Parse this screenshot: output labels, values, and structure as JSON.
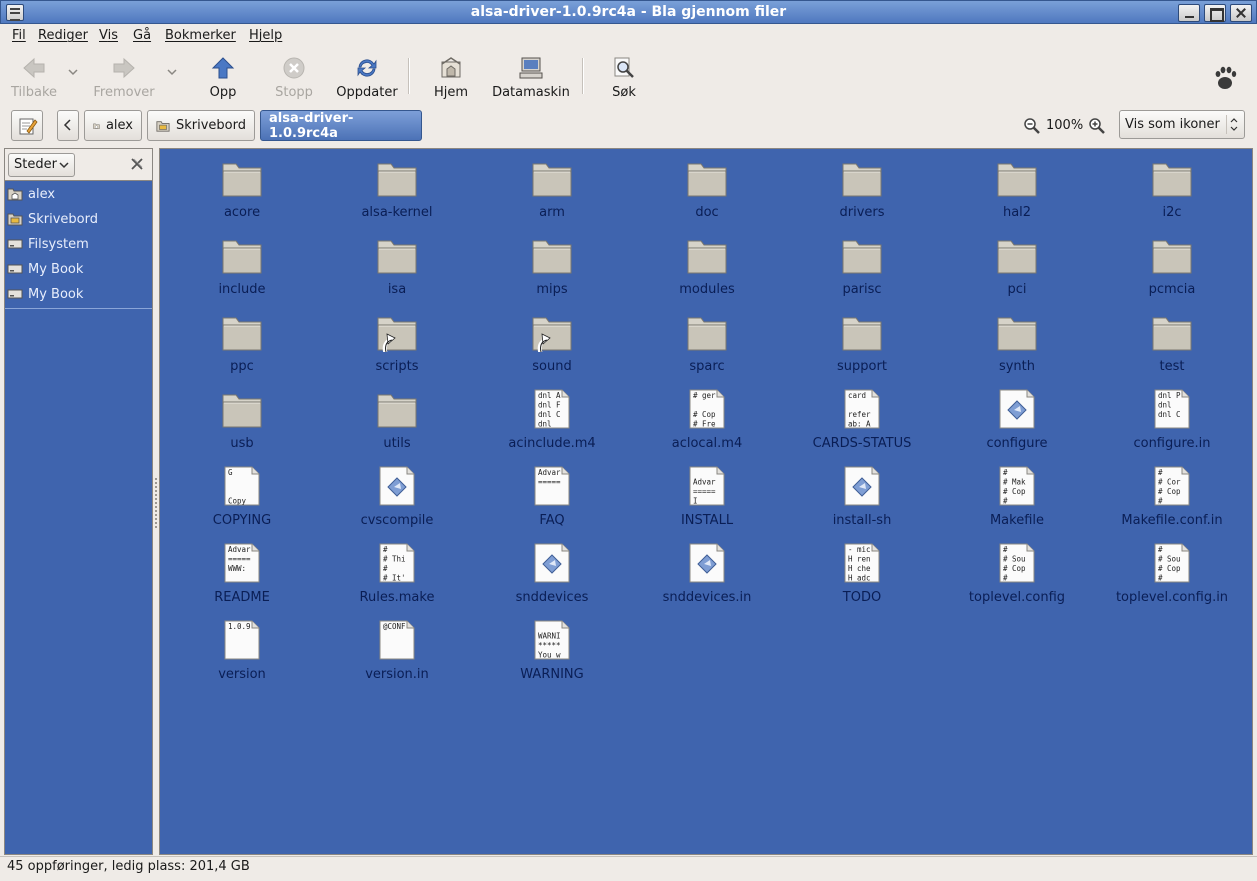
{
  "window": {
    "title": "alsa-driver-1.0.9rc4a - Bla gjennom filer"
  },
  "menubar": {
    "items": [
      {
        "label": "Fil",
        "accel": "F",
        "rest": "il"
      },
      {
        "label": "Rediger",
        "accel": "R",
        "rest": "ediger"
      },
      {
        "label": "Vis",
        "accel": "V",
        "rest": "is"
      },
      {
        "label": "Gå",
        "accel": "G",
        "rest": "å"
      },
      {
        "label": "Bokmerker",
        "accel": "B",
        "rest": "okmerker"
      },
      {
        "label": "Hjelp",
        "accel": "H",
        "rest": "jelp"
      }
    ]
  },
  "toolbar": {
    "back": "Tilbake",
    "forward": "Fremover",
    "up": "Opp",
    "stop": "Stopp",
    "reload": "Oppdater",
    "home": "Hjem",
    "computer": "Datamaskin",
    "search": "Søk"
  },
  "location": {
    "crumbs": [
      "alex",
      "Skrivebord",
      "alsa-driver-1.0.9rc4a"
    ],
    "zoom": "100%",
    "view_mode": "Vis som ikoner"
  },
  "sidepane": {
    "selector": "Steder",
    "places": [
      {
        "label": "alex",
        "icon": "home-folder-icon"
      },
      {
        "label": "Skrivebord",
        "icon": "desktop-icon"
      },
      {
        "label": "Filsystem",
        "icon": "drive-icon"
      },
      {
        "label": "My Book",
        "icon": "drive-icon"
      },
      {
        "label": "My Book",
        "icon": "drive-icon"
      }
    ]
  },
  "files": [
    {
      "name": "acore",
      "type": "folder"
    },
    {
      "name": "alsa-kernel",
      "type": "folder"
    },
    {
      "name": "arm",
      "type": "folder"
    },
    {
      "name": "doc",
      "type": "folder"
    },
    {
      "name": "drivers",
      "type": "folder"
    },
    {
      "name": "hal2",
      "type": "folder"
    },
    {
      "name": "i2c",
      "type": "folder"
    },
    {
      "name": "include",
      "type": "folder"
    },
    {
      "name": "isa",
      "type": "folder"
    },
    {
      "name": "mips",
      "type": "folder"
    },
    {
      "name": "modules",
      "type": "folder"
    },
    {
      "name": "parisc",
      "type": "folder"
    },
    {
      "name": "pci",
      "type": "folder"
    },
    {
      "name": "pcmcia",
      "type": "folder"
    },
    {
      "name": "ppc",
      "type": "folder"
    },
    {
      "name": "scripts",
      "type": "folder-link"
    },
    {
      "name": "sound",
      "type": "folder-link"
    },
    {
      "name": "sparc",
      "type": "folder"
    },
    {
      "name": "support",
      "type": "folder"
    },
    {
      "name": "synth",
      "type": "folder"
    },
    {
      "name": "test",
      "type": "folder"
    },
    {
      "name": "usb",
      "type": "folder"
    },
    {
      "name": "utils",
      "type": "folder"
    },
    {
      "name": "acinclude.m4",
      "type": "text",
      "preview": [
        "dnl A",
        "dnl F",
        "dnl C",
        "dnl"
      ]
    },
    {
      "name": "aclocal.m4",
      "type": "text",
      "preview": [
        "# ger",
        "",
        "# Cop",
        "# Fre"
      ]
    },
    {
      "name": "CARDS-STATUS",
      "type": "text",
      "preview": [
        "card",
        "",
        "refer",
        "ab: A"
      ]
    },
    {
      "name": "configure",
      "type": "script"
    },
    {
      "name": "configure.in",
      "type": "text",
      "preview": [
        "dnl P",
        "dnl",
        "dnl C",
        ""
      ]
    },
    {
      "name": "COPYING",
      "type": "text",
      "preview": [
        "    G",
        "",
        "",
        "Copy"
      ]
    },
    {
      "name": "cvscompile",
      "type": "script"
    },
    {
      "name": "FAQ",
      "type": "text",
      "preview": [
        "Advar",
        "=====",
        "",
        ""
      ]
    },
    {
      "name": "INSTALL",
      "type": "text",
      "preview": [
        "",
        "Advar",
        "=====",
        "    I"
      ]
    },
    {
      "name": "install-sh",
      "type": "script"
    },
    {
      "name": "Makefile",
      "type": "text",
      "preview": [
        "#",
        "# Mak",
        "# Cop",
        "#"
      ]
    },
    {
      "name": "Makefile.conf.in",
      "type": "text",
      "preview": [
        "#",
        "# Cor",
        "# Cop",
        "#"
      ]
    },
    {
      "name": "README",
      "type": "text",
      "preview": [
        "Advar",
        "=====",
        "WWW:",
        ""
      ]
    },
    {
      "name": "Rules.make",
      "type": "text",
      "preview": [
        "#",
        "# Thi",
        "#",
        "# It'"
      ]
    },
    {
      "name": "snddevices",
      "type": "script"
    },
    {
      "name": "snddevices.in",
      "type": "script"
    },
    {
      "name": "TODO",
      "type": "text",
      "preview": [
        "- mic",
        "H ren",
        "H che",
        "H adc"
      ]
    },
    {
      "name": "toplevel.config",
      "type": "text",
      "preview": [
        "#",
        "# Sou",
        "# Cop",
        "#"
      ]
    },
    {
      "name": "toplevel.config.in",
      "type": "text",
      "preview": [
        "#",
        "# Sou",
        "# Cop",
        "#"
      ]
    },
    {
      "name": "version",
      "type": "text",
      "preview": [
        "1.0.9",
        "",
        "",
        ""
      ]
    },
    {
      "name": "version.in",
      "type": "text",
      "preview": [
        "@CONF",
        "",
        "",
        ""
      ]
    },
    {
      "name": "WARNING",
      "type": "text",
      "preview": [
        "",
        "WARNI",
        "*****",
        "You w"
      ]
    }
  ],
  "statusbar": {
    "text": "45 oppføringer, ledig plass: 201,4 GB"
  },
  "colors": {
    "view_background": "#3f64ae",
    "titlebar": "#5a82c6",
    "selected_crumb": "#4c72b6"
  }
}
